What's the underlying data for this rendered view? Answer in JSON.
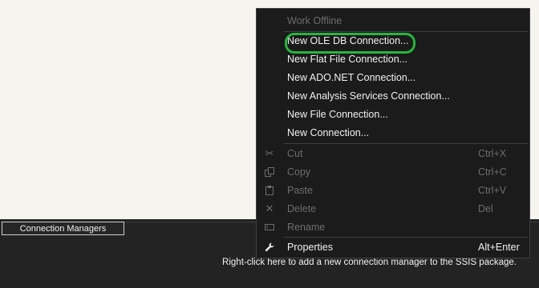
{
  "menu": {
    "items": [
      {
        "label": "Work Offline",
        "shortcut": "",
        "disabled": true,
        "icon": ""
      },
      {
        "label": "New OLE DB Connection...",
        "shortcut": "",
        "disabled": false,
        "icon": ""
      },
      {
        "label": "New Flat File Connection...",
        "shortcut": "",
        "disabled": false,
        "icon": ""
      },
      {
        "label": "New ADO.NET Connection...",
        "shortcut": "",
        "disabled": false,
        "icon": ""
      },
      {
        "label": "New Analysis Services Connection...",
        "shortcut": "",
        "disabled": false,
        "icon": ""
      },
      {
        "label": "New File Connection...",
        "shortcut": "",
        "disabled": false,
        "icon": ""
      },
      {
        "label": "New Connection...",
        "shortcut": "",
        "disabled": false,
        "icon": ""
      },
      {
        "label": "Cut",
        "shortcut": "Ctrl+X",
        "disabled": true,
        "icon": "scissors-icon"
      },
      {
        "label": "Copy",
        "shortcut": "Ctrl+C",
        "disabled": true,
        "icon": "copy-icon"
      },
      {
        "label": "Paste",
        "shortcut": "Ctrl+V",
        "disabled": true,
        "icon": "paste-icon"
      },
      {
        "label": "Delete",
        "shortcut": "Del",
        "disabled": true,
        "icon": "delete-icon"
      },
      {
        "label": "Rename",
        "shortcut": "",
        "disabled": true,
        "icon": "rename-icon"
      },
      {
        "label": "Properties",
        "shortcut": "Alt+Enter",
        "disabled": false,
        "icon": "wrench-icon"
      }
    ],
    "highlight_color": "#27b53e"
  },
  "connection_managers": {
    "tab_label": "Connection Managers",
    "hint": "Right-click here to add a new connection manager to the SSIS package."
  }
}
